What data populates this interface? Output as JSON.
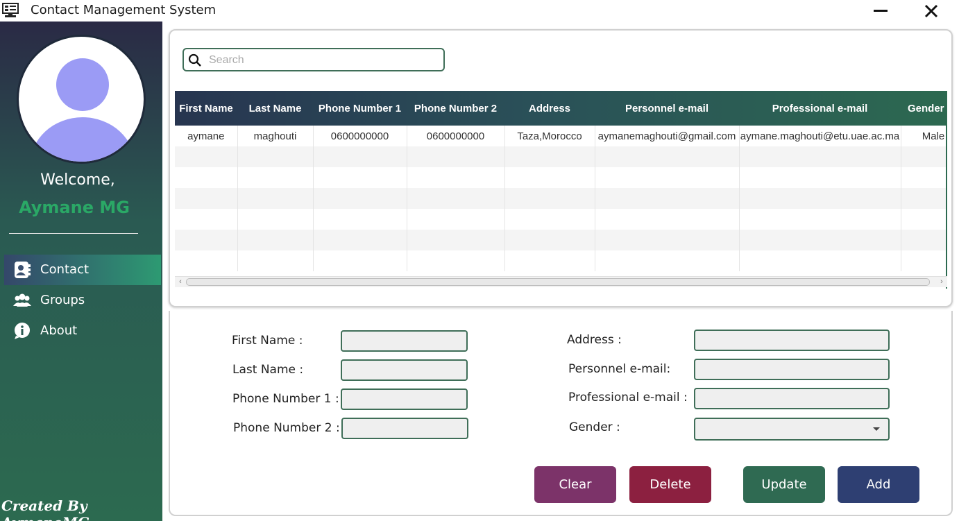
{
  "window": {
    "title": "Contact Management System"
  },
  "sidebar": {
    "welcome": "Welcome,",
    "username": "Aymane MG",
    "nav": [
      {
        "label": "Contact",
        "icon": "contact-book-icon",
        "active": true
      },
      {
        "label": "Groups",
        "icon": "users-icon",
        "active": false
      },
      {
        "label": "About",
        "icon": "info-icon",
        "active": false
      }
    ],
    "footer": "Created By AymaneMG"
  },
  "search": {
    "placeholder": "Search",
    "value": ""
  },
  "table": {
    "columns": [
      "First Name",
      "Last Name",
      "Phone Number 1",
      "Phone Number 2",
      "Address",
      "Personnel e-mail",
      "Professional e-mail",
      "Gender"
    ],
    "rows": [
      [
        "aymane",
        "maghouti",
        "0600000000",
        "0600000000",
        "Taza,Morocco",
        "aymanemaghouti@gmail.com",
        "aymane.maghouti@etu.uae.ac.ma",
        "Male"
      ],
      [
        "",
        "",
        "",
        "",
        "",
        "",
        "",
        ""
      ],
      [
        "",
        "",
        "",
        "",
        "",
        "",
        "",
        ""
      ],
      [
        "",
        "",
        "",
        "",
        "",
        "",
        "",
        ""
      ],
      [
        "",
        "",
        "",
        "",
        "",
        "",
        "",
        ""
      ],
      [
        "",
        "",
        "",
        "",
        "",
        "",
        "",
        ""
      ],
      [
        "",
        "",
        "",
        "",
        "",
        "",
        "",
        ""
      ]
    ]
  },
  "form": {
    "first_name_label": "First Name :",
    "last_name_label": "Last Name :",
    "phone1_label": "Phone Number 1 :",
    "phone2_label": "Phone Number 2 :",
    "address_label": "Address :",
    "personnel_email_label": "Personnel e-mail:",
    "professional_email_label": "Professional e-mail :",
    "gender_label": "Gender :",
    "gender_value": ""
  },
  "buttons": {
    "clear": "Clear",
    "delete": "Delete",
    "update": "Update",
    "add": "Add"
  },
  "colors": {
    "accent_green": "#2aa866",
    "clear_button": "#7c3369",
    "delete_button": "#8c2040",
    "update_button": "#2f6a52",
    "add_button": "#2e3f72"
  }
}
